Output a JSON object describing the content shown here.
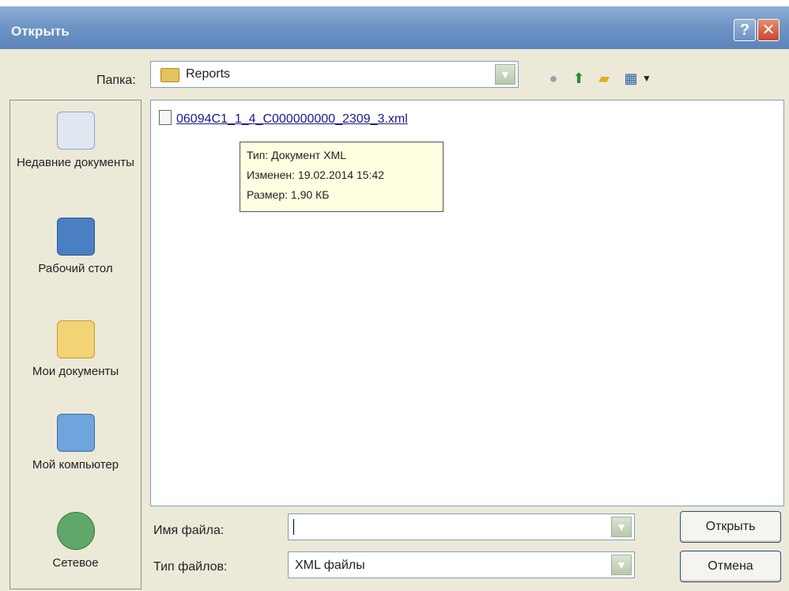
{
  "window": {
    "title": "Открыть",
    "help_glyph": "?",
    "close_glyph": "✕"
  },
  "toolbar": {
    "folder_label": "Папка:",
    "folder_value": "Reports",
    "icons": [
      "back-icon",
      "up-folder-icon",
      "new-folder-icon",
      "view-menu-icon"
    ]
  },
  "places": [
    {
      "label": "Недавние документы",
      "icon": "recent-documents-icon"
    },
    {
      "label": "Рабочий стол",
      "icon": "desktop-icon"
    },
    {
      "label": "Мои документы",
      "icon": "my-documents-icon"
    },
    {
      "label": "Мой компьютер",
      "icon": "my-computer-icon"
    },
    {
      "label": "Сетевое",
      "icon": "network-icon"
    }
  ],
  "files": [
    {
      "name": "06094C1_1_4_C000000000_2309_3.xml"
    }
  ],
  "tooltip": {
    "type": "Тип: Документ XML",
    "modified": "Изменен: 19.02.2014 15:42",
    "size": "Размер: 1,90 КБ"
  },
  "bottom": {
    "filename_label": "Имя файла:",
    "filename_value": "",
    "filetype_label": "Тип файлов:",
    "filetype_value": "XML файлы",
    "open_button": "Открыть",
    "cancel_button": "Отмена"
  }
}
